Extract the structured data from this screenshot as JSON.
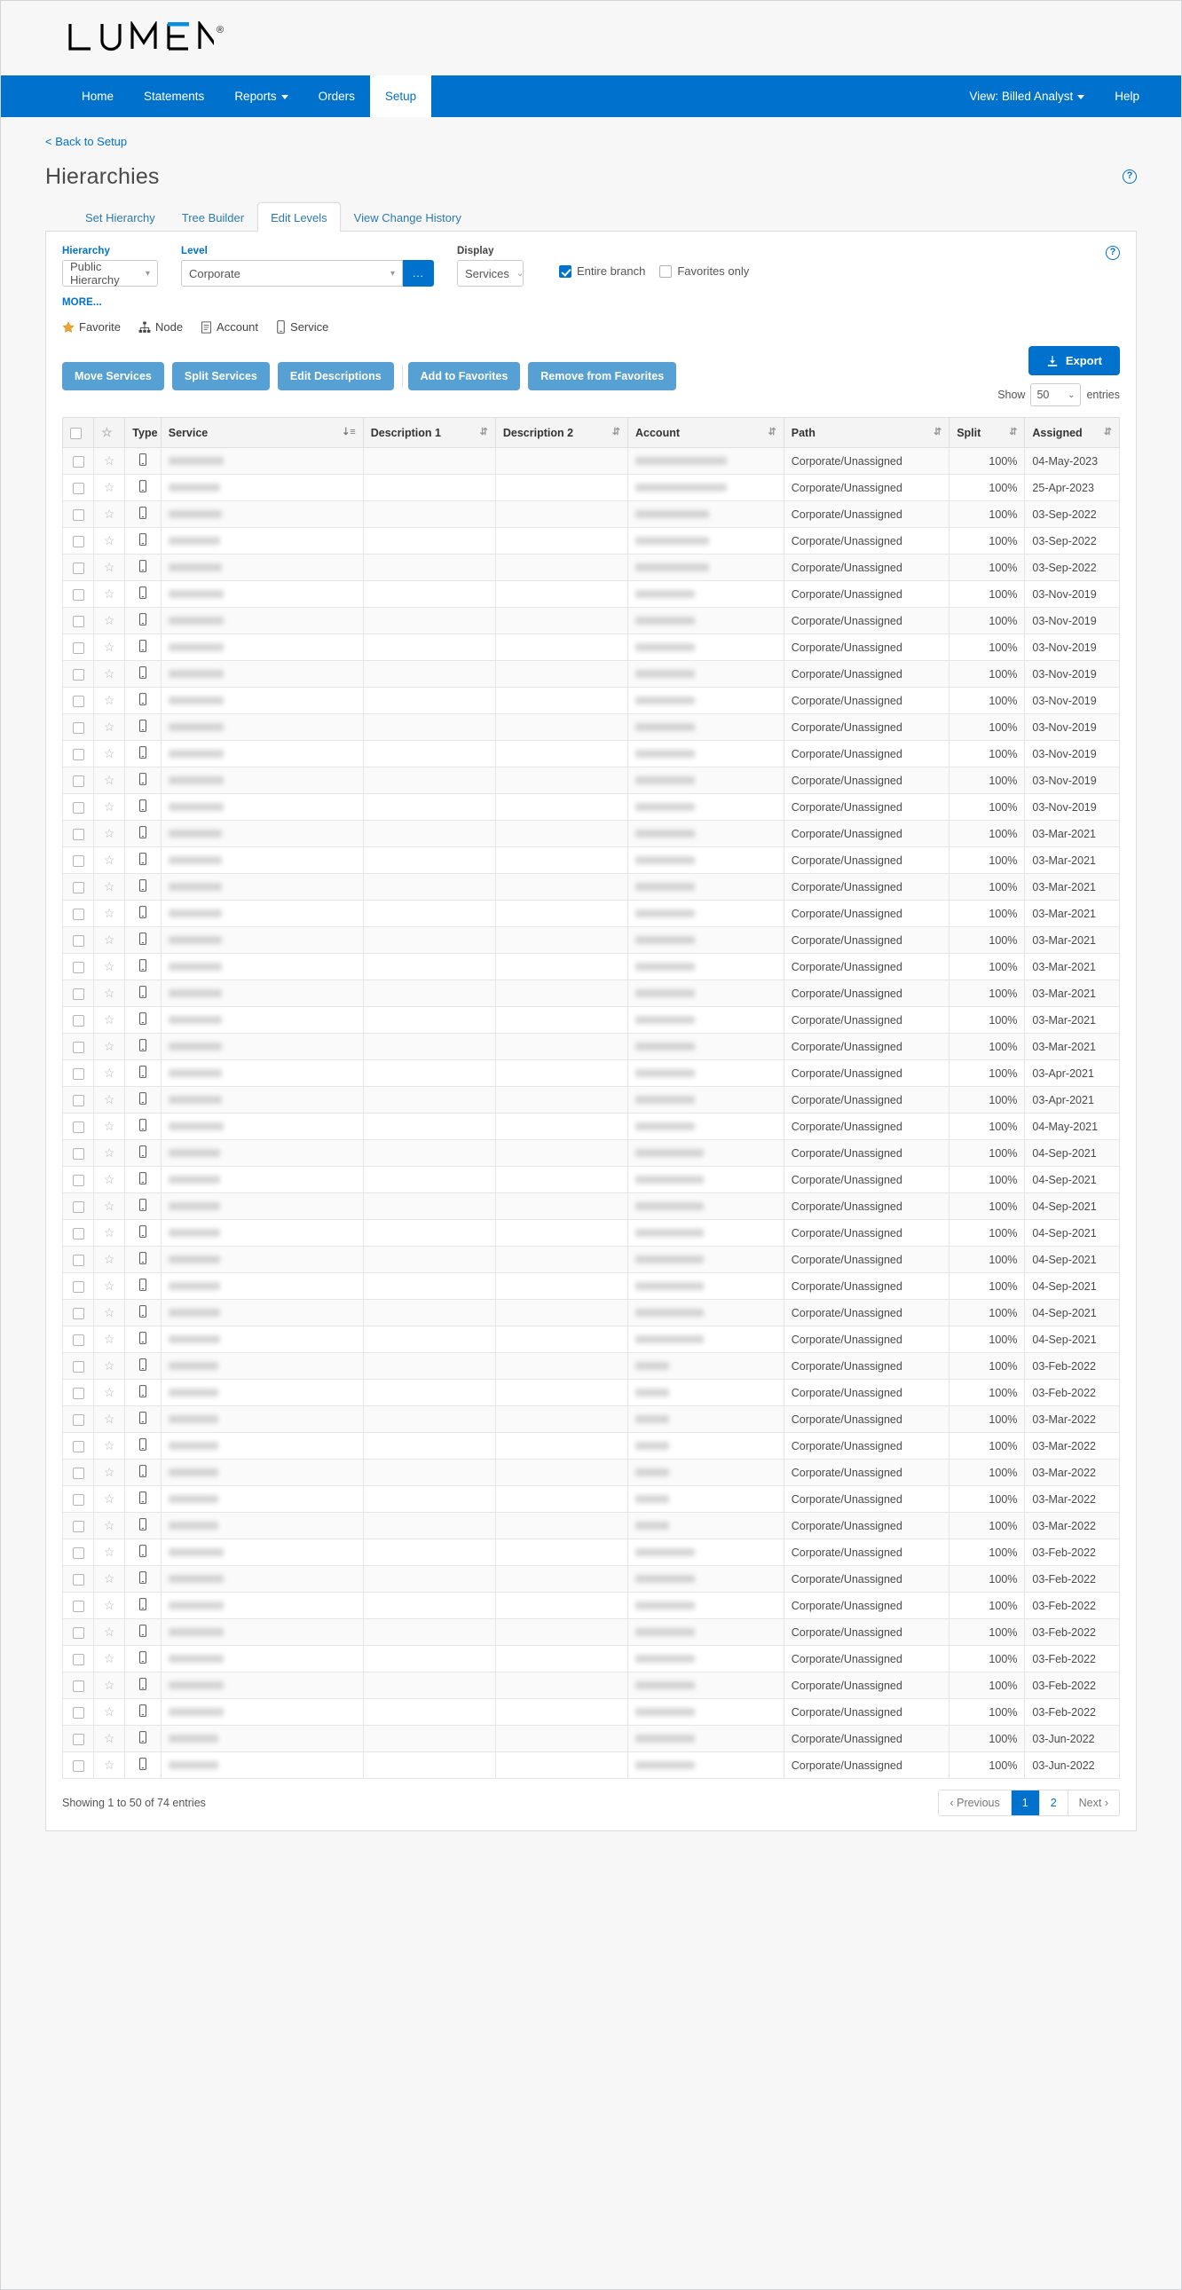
{
  "brand": {
    "name": "LUMEN",
    "registered": "®"
  },
  "nav": {
    "left": [
      {
        "label": "Home",
        "active": false,
        "caret": false
      },
      {
        "label": "Statements",
        "active": false,
        "caret": false
      },
      {
        "label": "Reports",
        "active": false,
        "caret": true
      },
      {
        "label": "Orders",
        "active": false,
        "caret": false
      },
      {
        "label": "Setup",
        "active": true,
        "caret": false
      }
    ],
    "right": [
      {
        "label": "View: Billed Analyst",
        "caret": true
      },
      {
        "label": "Help",
        "caret": false
      }
    ]
  },
  "breadcrumb": {
    "back_label": "< Back to Setup"
  },
  "header": {
    "title": "Hierarchies",
    "help_glyph": "?"
  },
  "tabs": [
    {
      "label": "Set Hierarchy",
      "active": false
    },
    {
      "label": "Tree Builder",
      "active": false
    },
    {
      "label": "Edit Levels",
      "active": true
    },
    {
      "label": "View Change History",
      "active": false
    }
  ],
  "filters": {
    "hierarchy": {
      "label": "Hierarchy",
      "value": "Public Hierarchy"
    },
    "level": {
      "label": "Level",
      "value": "Corporate",
      "ellipsis_label": "..."
    },
    "display": {
      "label": "Display",
      "value": "Services"
    },
    "entire_branch": {
      "label": "Entire branch",
      "checked": true
    },
    "favorites_only": {
      "label": "Favorites only",
      "checked": false
    },
    "more_label": "MORE...",
    "help_glyph": "?"
  },
  "legend": [
    {
      "label": "Favorite",
      "icon": "star-icon"
    },
    {
      "label": "Node",
      "icon": "sitemap-icon"
    },
    {
      "label": "Account",
      "icon": "document-icon"
    },
    {
      "label": "Service",
      "icon": "mobile-icon"
    }
  ],
  "actions": {
    "primary": [
      {
        "label": "Move Services"
      },
      {
        "label": "Split Services"
      },
      {
        "label": "Edit Descriptions"
      }
    ],
    "favorites": [
      {
        "label": "Add to Favorites"
      },
      {
        "label": "Remove from Favorites"
      }
    ],
    "export": {
      "label": "Export",
      "icon": "download-icon"
    }
  },
  "show_entries": {
    "prefix": "Show",
    "value": "50",
    "suffix": "entries"
  },
  "table": {
    "columns": [
      {
        "key": "check",
        "label": "",
        "sortable": false
      },
      {
        "key": "star",
        "label": "",
        "sortable": false
      },
      {
        "key": "type",
        "label": "Type",
        "sortable": false
      },
      {
        "key": "service",
        "label": "Service",
        "sortable": true,
        "sorted": true
      },
      {
        "key": "desc1",
        "label": "Description 1",
        "sortable": true
      },
      {
        "key": "desc2",
        "label": "Description 2",
        "sortable": true
      },
      {
        "key": "account",
        "label": "Account",
        "sortable": true
      },
      {
        "key": "path",
        "label": "Path",
        "sortable": true
      },
      {
        "key": "split",
        "label": "Split",
        "sortable": true
      },
      {
        "key": "assigned",
        "label": "Assigned",
        "sortable": true
      }
    ],
    "rows": [
      {
        "service_w": 62,
        "account_w": 103,
        "path": "Corporate/Unassigned",
        "split": "100%",
        "assigned": "04-May-2023"
      },
      {
        "service_w": 58,
        "account_w": 103,
        "path": "Corporate/Unassigned",
        "split": "100%",
        "assigned": "25-Apr-2023"
      },
      {
        "service_w": 60,
        "account_w": 83,
        "path": "Corporate/Unassigned",
        "split": "100%",
        "assigned": "03-Sep-2022"
      },
      {
        "service_w": 58,
        "account_w": 83,
        "path": "Corporate/Unassigned",
        "split": "100%",
        "assigned": "03-Sep-2022"
      },
      {
        "service_w": 60,
        "account_w": 83,
        "path": "Corporate/Unassigned",
        "split": "100%",
        "assigned": "03-Sep-2022"
      },
      {
        "service_w": 62,
        "account_w": 67,
        "path": "Corporate/Unassigned",
        "split": "100%",
        "assigned": "03-Nov-2019"
      },
      {
        "service_w": 62,
        "account_w": 67,
        "path": "Corporate/Unassigned",
        "split": "100%",
        "assigned": "03-Nov-2019"
      },
      {
        "service_w": 62,
        "account_w": 67,
        "path": "Corporate/Unassigned",
        "split": "100%",
        "assigned": "03-Nov-2019"
      },
      {
        "service_w": 62,
        "account_w": 67,
        "path": "Corporate/Unassigned",
        "split": "100%",
        "assigned": "03-Nov-2019"
      },
      {
        "service_w": 62,
        "account_w": 67,
        "path": "Corporate/Unassigned",
        "split": "100%",
        "assigned": "03-Nov-2019"
      },
      {
        "service_w": 62,
        "account_w": 67,
        "path": "Corporate/Unassigned",
        "split": "100%",
        "assigned": "03-Nov-2019"
      },
      {
        "service_w": 62,
        "account_w": 67,
        "path": "Corporate/Unassigned",
        "split": "100%",
        "assigned": "03-Nov-2019"
      },
      {
        "service_w": 62,
        "account_w": 67,
        "path": "Corporate/Unassigned",
        "split": "100%",
        "assigned": "03-Nov-2019"
      },
      {
        "service_w": 62,
        "account_w": 67,
        "path": "Corporate/Unassigned",
        "split": "100%",
        "assigned": "03-Nov-2019"
      },
      {
        "service_w": 60,
        "account_w": 67,
        "path": "Corporate/Unassigned",
        "split": "100%",
        "assigned": "03-Mar-2021"
      },
      {
        "service_w": 60,
        "account_w": 67,
        "path": "Corporate/Unassigned",
        "split": "100%",
        "assigned": "03-Mar-2021"
      },
      {
        "service_w": 60,
        "account_w": 67,
        "path": "Corporate/Unassigned",
        "split": "100%",
        "assigned": "03-Mar-2021"
      },
      {
        "service_w": 60,
        "account_w": 67,
        "path": "Corporate/Unassigned",
        "split": "100%",
        "assigned": "03-Mar-2021"
      },
      {
        "service_w": 60,
        "account_w": 67,
        "path": "Corporate/Unassigned",
        "split": "100%",
        "assigned": "03-Mar-2021"
      },
      {
        "service_w": 60,
        "account_w": 67,
        "path": "Corporate/Unassigned",
        "split": "100%",
        "assigned": "03-Mar-2021"
      },
      {
        "service_w": 60,
        "account_w": 67,
        "path": "Corporate/Unassigned",
        "split": "100%",
        "assigned": "03-Mar-2021"
      },
      {
        "service_w": 60,
        "account_w": 67,
        "path": "Corporate/Unassigned",
        "split": "100%",
        "assigned": "03-Mar-2021"
      },
      {
        "service_w": 60,
        "account_w": 67,
        "path": "Corporate/Unassigned",
        "split": "100%",
        "assigned": "03-Mar-2021"
      },
      {
        "service_w": 60,
        "account_w": 67,
        "path": "Corporate/Unassigned",
        "split": "100%",
        "assigned": "03-Apr-2021"
      },
      {
        "service_w": 60,
        "account_w": 67,
        "path": "Corporate/Unassigned",
        "split": "100%",
        "assigned": "03-Apr-2021"
      },
      {
        "service_w": 62,
        "account_w": 67,
        "path": "Corporate/Unassigned",
        "split": "100%",
        "assigned": "04-May-2021"
      },
      {
        "service_w": 58,
        "account_w": 77,
        "path": "Corporate/Unassigned",
        "split": "100%",
        "assigned": "04-Sep-2021"
      },
      {
        "service_w": 58,
        "account_w": 77,
        "path": "Corporate/Unassigned",
        "split": "100%",
        "assigned": "04-Sep-2021"
      },
      {
        "service_w": 58,
        "account_w": 77,
        "path": "Corporate/Unassigned",
        "split": "100%",
        "assigned": "04-Sep-2021"
      },
      {
        "service_w": 58,
        "account_w": 77,
        "path": "Corporate/Unassigned",
        "split": "100%",
        "assigned": "04-Sep-2021"
      },
      {
        "service_w": 58,
        "account_w": 77,
        "path": "Corporate/Unassigned",
        "split": "100%",
        "assigned": "04-Sep-2021"
      },
      {
        "service_w": 58,
        "account_w": 77,
        "path": "Corporate/Unassigned",
        "split": "100%",
        "assigned": "04-Sep-2021"
      },
      {
        "service_w": 58,
        "account_w": 77,
        "path": "Corporate/Unassigned",
        "split": "100%",
        "assigned": "04-Sep-2021"
      },
      {
        "service_w": 58,
        "account_w": 77,
        "path": "Corporate/Unassigned",
        "split": "100%",
        "assigned": "04-Sep-2021"
      },
      {
        "service_w": 56,
        "account_w": 38,
        "path": "Corporate/Unassigned",
        "split": "100%",
        "assigned": "03-Feb-2022"
      },
      {
        "service_w": 56,
        "account_w": 38,
        "path": "Corporate/Unassigned",
        "split": "100%",
        "assigned": "03-Feb-2022"
      },
      {
        "service_w": 56,
        "account_w": 38,
        "path": "Corporate/Unassigned",
        "split": "100%",
        "assigned": "03-Mar-2022"
      },
      {
        "service_w": 56,
        "account_w": 38,
        "path": "Corporate/Unassigned",
        "split": "100%",
        "assigned": "03-Mar-2022"
      },
      {
        "service_w": 56,
        "account_w": 38,
        "path": "Corporate/Unassigned",
        "split": "100%",
        "assigned": "03-Mar-2022"
      },
      {
        "service_w": 56,
        "account_w": 38,
        "path": "Corporate/Unassigned",
        "split": "100%",
        "assigned": "03-Mar-2022"
      },
      {
        "service_w": 56,
        "account_w": 38,
        "path": "Corporate/Unassigned",
        "split": "100%",
        "assigned": "03-Mar-2022"
      },
      {
        "service_w": 62,
        "account_w": 67,
        "path": "Corporate/Unassigned",
        "split": "100%",
        "assigned": "03-Feb-2022"
      },
      {
        "service_w": 62,
        "account_w": 67,
        "path": "Corporate/Unassigned",
        "split": "100%",
        "assigned": "03-Feb-2022"
      },
      {
        "service_w": 62,
        "account_w": 67,
        "path": "Corporate/Unassigned",
        "split": "100%",
        "assigned": "03-Feb-2022"
      },
      {
        "service_w": 62,
        "account_w": 67,
        "path": "Corporate/Unassigned",
        "split": "100%",
        "assigned": "03-Feb-2022"
      },
      {
        "service_w": 62,
        "account_w": 67,
        "path": "Corporate/Unassigned",
        "split": "100%",
        "assigned": "03-Feb-2022"
      },
      {
        "service_w": 62,
        "account_w": 67,
        "path": "Corporate/Unassigned",
        "split": "100%",
        "assigned": "03-Feb-2022"
      },
      {
        "service_w": 62,
        "account_w": 67,
        "path": "Corporate/Unassigned",
        "split": "100%",
        "assigned": "03-Feb-2022"
      },
      {
        "service_w": 56,
        "account_w": 67,
        "path": "Corporate/Unassigned",
        "split": "100%",
        "assigned": "03-Jun-2022"
      },
      {
        "service_w": 56,
        "account_w": 67,
        "path": "Corporate/Unassigned",
        "split": "100%",
        "assigned": "03-Jun-2022"
      }
    ]
  },
  "footer": {
    "info": "Showing 1 to 50 of 74 entries",
    "pages": [
      {
        "label": "‹ Previous",
        "active": false,
        "muted": true
      },
      {
        "label": "1",
        "active": true,
        "muted": false
      },
      {
        "label": "2",
        "active": false,
        "muted": false
      },
      {
        "label": "Next ›",
        "active": false,
        "muted": true
      }
    ]
  },
  "colors": {
    "brand_blue": "#0072ce",
    "button_blue": "#56a0d3",
    "star_orange": "#f0a32e"
  }
}
